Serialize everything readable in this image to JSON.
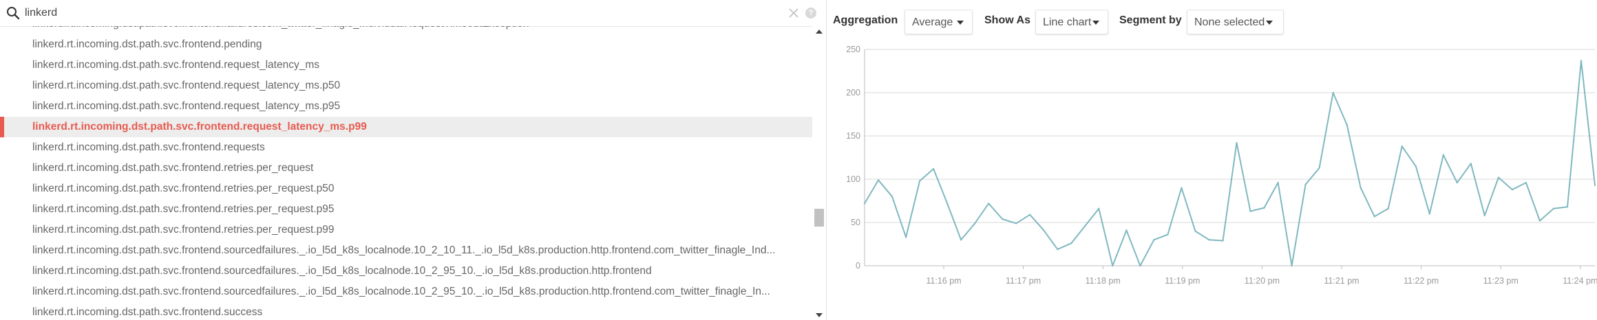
{
  "search": {
    "value": "linkerd",
    "help_glyph": "?"
  },
  "metrics": [
    {
      "label": "linkerd.rt.incoming.dst.path.svc.frontend.failures.com_twitter_finagle_IndividualRequestTimeoutException",
      "selected": false
    },
    {
      "label": "linkerd.rt.incoming.dst.path.svc.frontend.pending",
      "selected": false
    },
    {
      "label": "linkerd.rt.incoming.dst.path.svc.frontend.request_latency_ms",
      "selected": false
    },
    {
      "label": "linkerd.rt.incoming.dst.path.svc.frontend.request_latency_ms.p50",
      "selected": false
    },
    {
      "label": "linkerd.rt.incoming.dst.path.svc.frontend.request_latency_ms.p95",
      "selected": false
    },
    {
      "label": "linkerd.rt.incoming.dst.path.svc.frontend.request_latency_ms.p99",
      "selected": true
    },
    {
      "label": "linkerd.rt.incoming.dst.path.svc.frontend.requests",
      "selected": false
    },
    {
      "label": "linkerd.rt.incoming.dst.path.svc.frontend.retries.per_request",
      "selected": false
    },
    {
      "label": "linkerd.rt.incoming.dst.path.svc.frontend.retries.per_request.p50",
      "selected": false
    },
    {
      "label": "linkerd.rt.incoming.dst.path.svc.frontend.retries.per_request.p95",
      "selected": false
    },
    {
      "label": "linkerd.rt.incoming.dst.path.svc.frontend.retries.per_request.p99",
      "selected": false
    },
    {
      "label": "linkerd.rt.incoming.dst.path.svc.frontend.sourcedfailures._.io_l5d_k8s_localnode.10_2_10_11._.io_l5d_k8s.production.http.frontend.com_twitter_finagle_Ind...",
      "selected": false
    },
    {
      "label": "linkerd.rt.incoming.dst.path.svc.frontend.sourcedfailures._.io_l5d_k8s_localnode.10_2_95_10._.io_l5d_k8s.production.http.frontend",
      "selected": false
    },
    {
      "label": "linkerd.rt.incoming.dst.path.svc.frontend.sourcedfailures._.io_l5d_k8s_localnode.10_2_95_10._.io_l5d_k8s.production.http.frontend.com_twitter_finagle_In...",
      "selected": false
    },
    {
      "label": "linkerd.rt.incoming.dst.path.svc.frontend.success",
      "selected": false
    }
  ],
  "toolbar": {
    "aggregation_label": "Aggregation",
    "aggregation_value": "Average",
    "show_as_label": "Show As",
    "show_as_value": "Line chart",
    "segment_label": "Segment by",
    "segment_value": "None selected"
  },
  "colors": {
    "selected_accent": "#e85a4f",
    "series_line": "#7fb8bf",
    "grid": "#d8d8d8"
  },
  "chart_data": {
    "type": "line",
    "title": "",
    "xlabel": "",
    "ylabel": "",
    "ylim": [
      0,
      250
    ],
    "yticks": [
      0,
      50,
      100,
      150,
      200,
      250
    ],
    "xtick_labels": [
      "11:16 pm",
      "11:17 pm",
      "11:18 pm",
      "11:19 pm",
      "11:20 pm",
      "11:21 pm",
      "11:22 pm",
      "11:23 pm",
      "11:24 pm"
    ],
    "grid": true,
    "legend": "none",
    "series": [
      {
        "values": [
          72,
          99,
          80,
          33,
          98,
          112,
          72,
          30,
          49,
          72,
          54,
          49,
          59,
          41,
          19,
          26,
          46,
          66,
          0,
          41,
          0,
          30,
          36,
          90,
          40,
          30,
          29,
          142,
          63,
          67,
          96,
          0,
          94,
          113,
          200,
          163,
          90,
          57,
          66,
          138,
          115,
          60,
          128,
          96,
          118,
          58,
          102,
          88,
          96,
          52,
          66,
          68,
          237,
          93
        ]
      }
    ]
  }
}
